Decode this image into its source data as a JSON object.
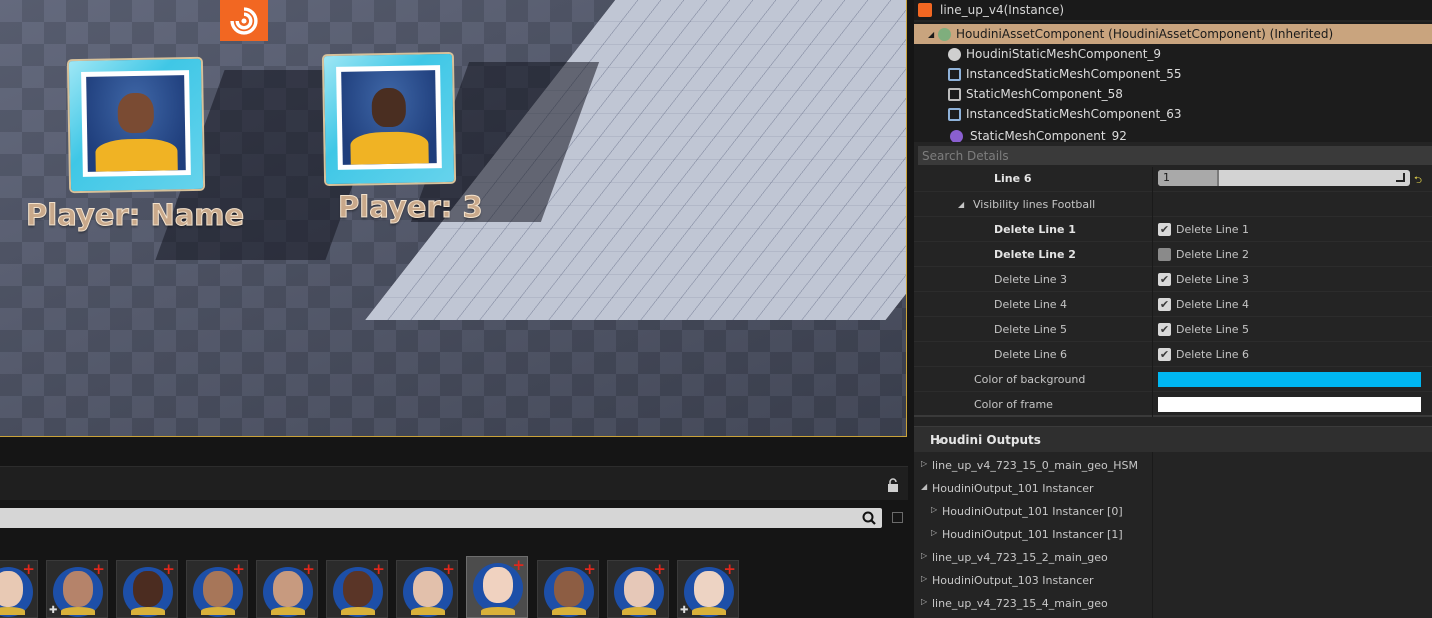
{
  "viewport": {
    "labels": [
      "Player: Name",
      "Player: 3"
    ]
  },
  "details": {
    "title": "line_up_v4(Instance)",
    "tree": [
      {
        "label": "HoudiniAssetComponent (HoudiniAssetComponent) (Inherited)",
        "icon": "houdini-asset-component-icon",
        "selected": true
      },
      {
        "label": "HoudiniStaticMeshComponent_9",
        "icon": "static-mesh-sphere-icon"
      },
      {
        "label": "InstancedStaticMeshComponent_55",
        "icon": "instanced-mesh-icon"
      },
      {
        "label": "StaticMeshComponent_58",
        "icon": "static-mesh-icon"
      },
      {
        "label": "InstancedStaticMeshComponent_63",
        "icon": "instanced-mesh-icon"
      },
      {
        "label": "StaticMeshComponent_92",
        "icon": "static-mesh-purple-icon"
      }
    ],
    "search_placeholder": "Search Details",
    "line6": {
      "label": "Line 6",
      "value": "1"
    },
    "group_label": "Visibility lines Football",
    "delete_lines": [
      {
        "label": "Delete Line 1",
        "checkbox_label": "Delete Line 1",
        "checked": true,
        "bold": true
      },
      {
        "label": "Delete Line 2",
        "checkbox_label": "Delete Line 2",
        "checked": false,
        "bold": true
      },
      {
        "label": "Delete Line 3",
        "checkbox_label": "Delete Line 3",
        "checked": true,
        "bold": false
      },
      {
        "label": "Delete Line 4",
        "checkbox_label": "Delete Line 4",
        "checked": true,
        "bold": false
      },
      {
        "label": "Delete Line 5",
        "checkbox_label": "Delete Line 5",
        "checked": true,
        "bold": false
      },
      {
        "label": "Delete Line 6",
        "checkbox_label": "Delete Line 6",
        "checked": true,
        "bold": false
      }
    ],
    "color_background": {
      "label": "Color of background",
      "color": "#00b7f2"
    },
    "color_frame": {
      "label": "Color of frame",
      "color": "#ffffff"
    },
    "outputs_header": "Houdini Outputs",
    "outputs": [
      {
        "label": "line_up_v4_723_15_0_main_geo_HSM",
        "expanded": false
      },
      {
        "label": "HoudiniOutput_101 Instancer",
        "expanded": true
      },
      {
        "label": "HoudiniOutput_101 Instancer [0]",
        "expanded": false
      },
      {
        "label": "HoudiniOutput_101 Instancer [1]",
        "expanded": false
      },
      {
        "label": "line_up_v4_723_15_2_main_geo",
        "expanded": false
      },
      {
        "label": "HoudiniOutput_103 Instancer",
        "expanded": false
      },
      {
        "label": "line_up_v4_723_15_4_main_geo",
        "expanded": false
      }
    ]
  },
  "colors": {
    "accent_selection": "#c9a47e",
    "viewport_border": "#c9a23a",
    "houdini_orange": "#f26722"
  }
}
